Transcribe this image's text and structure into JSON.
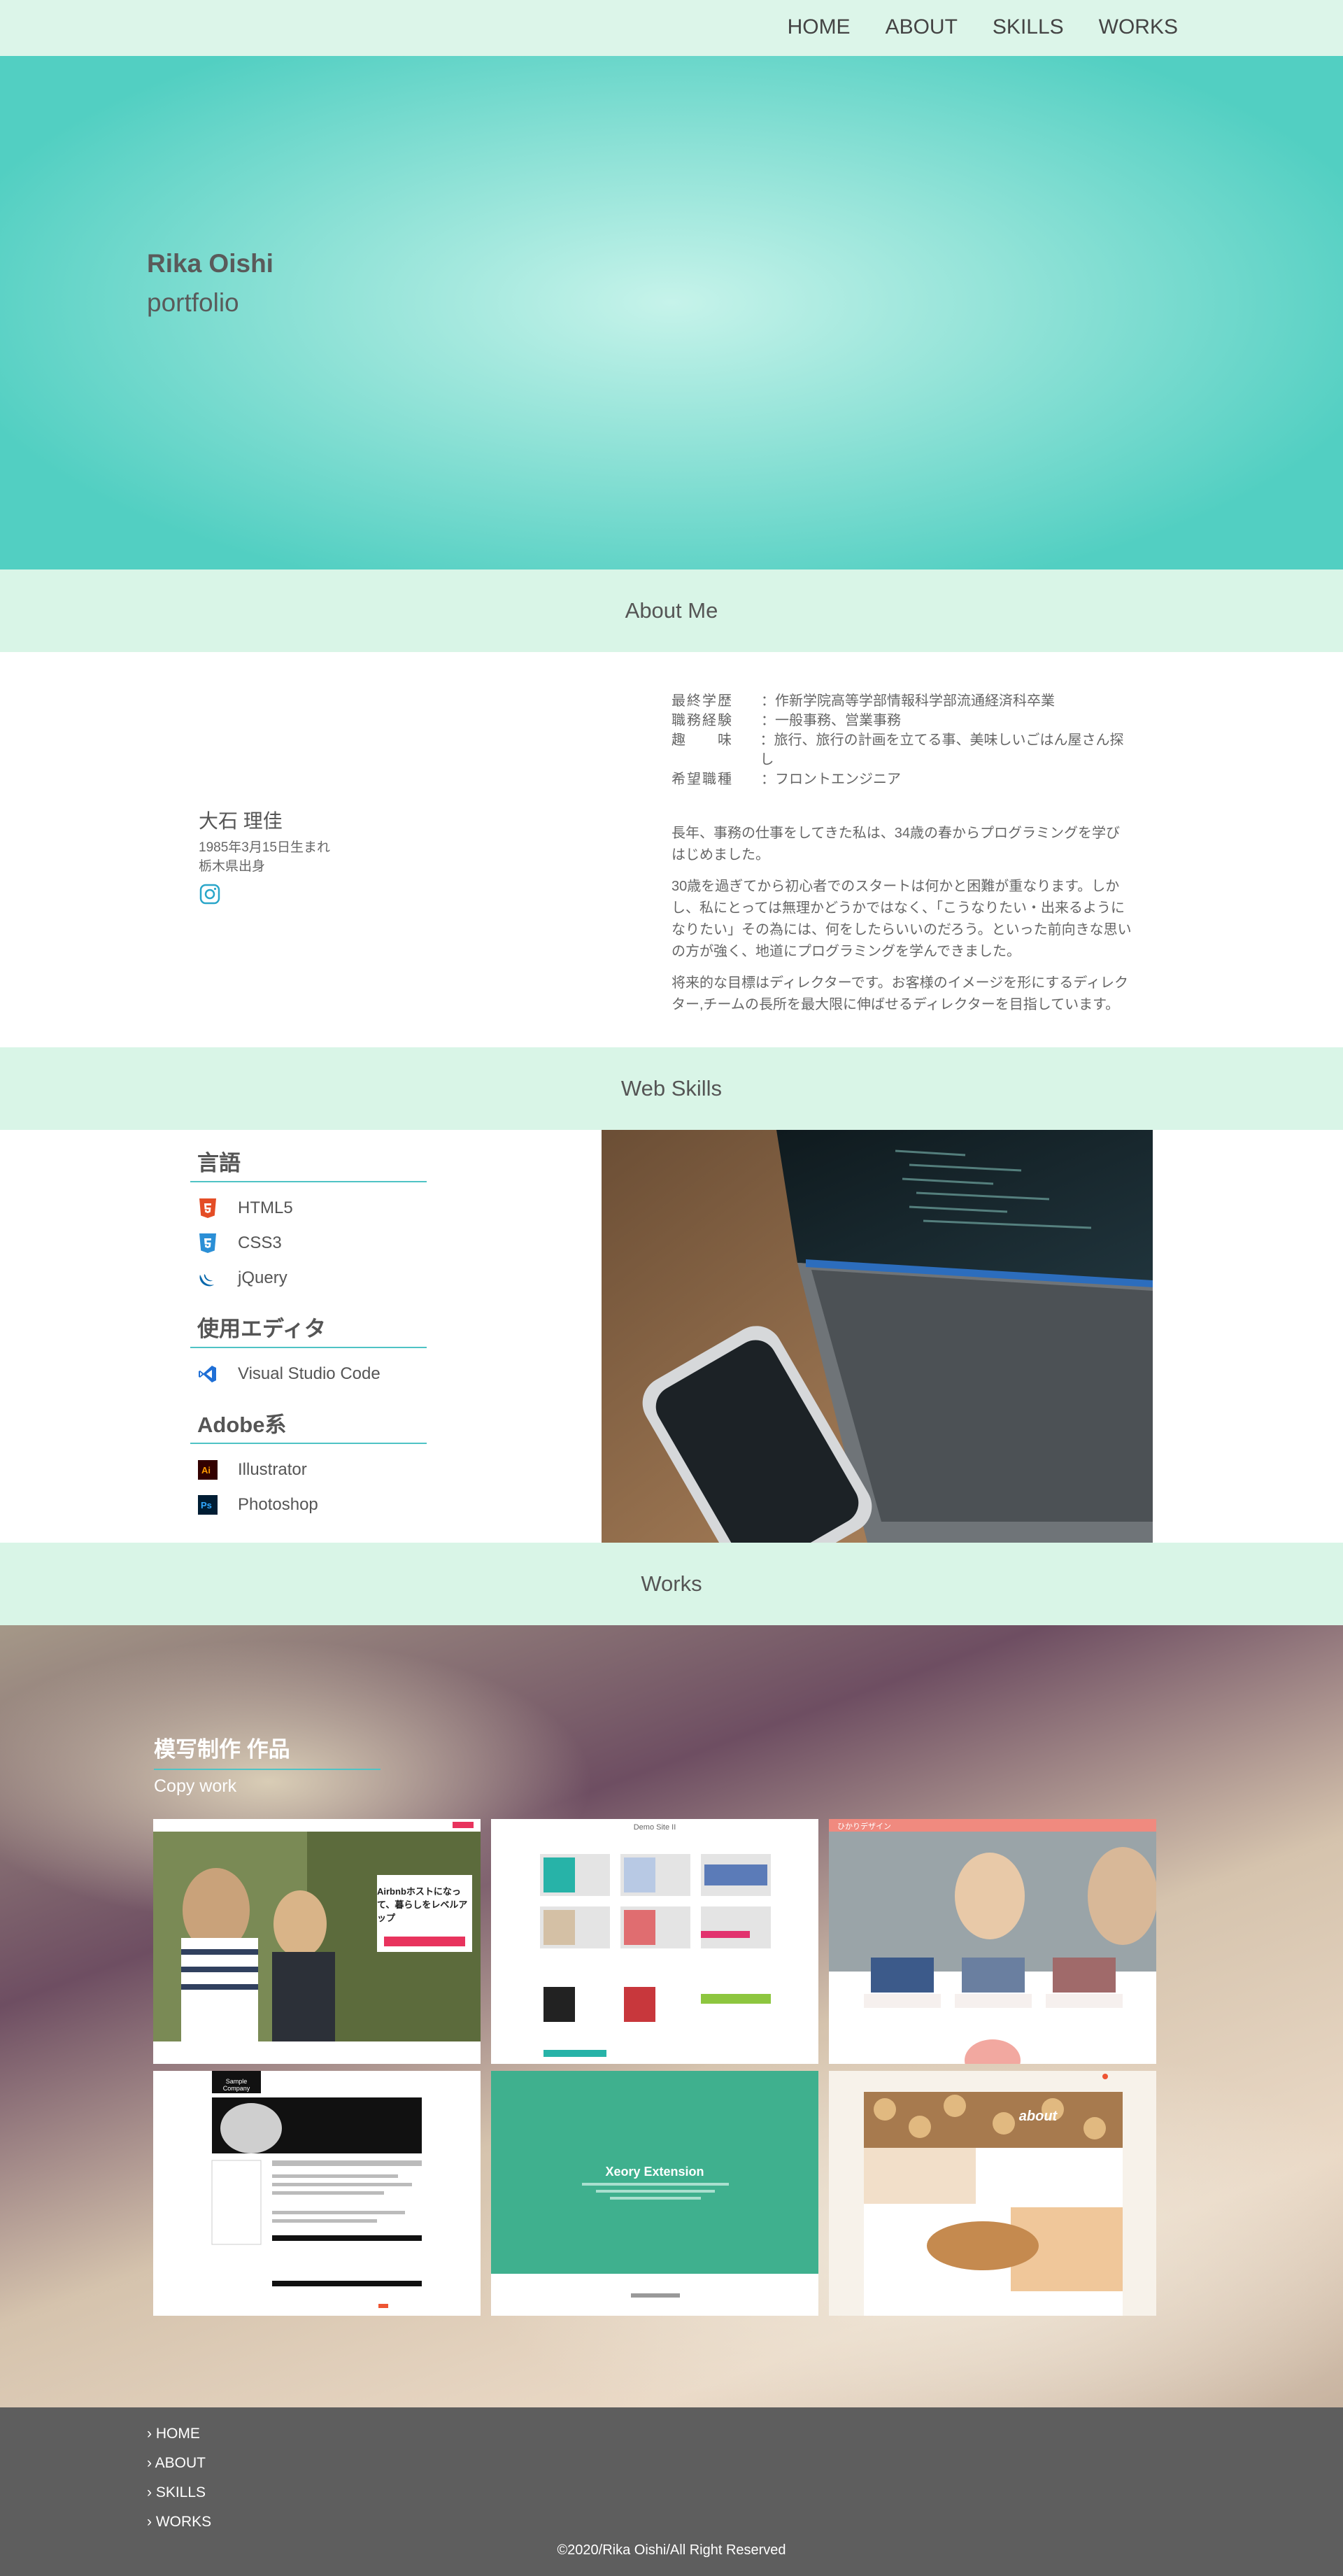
{
  "nav": {
    "items": [
      "HOME",
      "ABOUT",
      "SKILLS",
      "WORKS"
    ]
  },
  "hero": {
    "name": "Rika Oishi",
    "subtitle": "portfolio"
  },
  "about": {
    "heading": "About Me",
    "name_jp": "大石 理佳",
    "birth": "1985年3月15日生まれ",
    "origin": "栃木県出身",
    "details": [
      {
        "key": "最終学歴",
        "value": "：作新学院高等学部情報科学部流通経済科卒業"
      },
      {
        "key": "職務経験",
        "value": "：一般事務、営業事務"
      },
      {
        "key": "趣　　味",
        "value": "：旅行、旅行の計画を立てる事、美味しいごはん屋さん探し"
      },
      {
        "key": "希望職種",
        "value": "：フロントエンジニア"
      }
    ],
    "paragraphs": [
      "長年、事務の仕事をしてきた私は、34歳の春からプログラミングを学びはじめました。",
      "30歳を過ぎてから初心者でのスタートは何かと困難が重なります。しかし、私にとっては無理かどうかではなく、「こうなりたい・出来るようになりたい」その為には、何をしたらいいのだろう。といった前向きな思いの方が強く、地道にプログラミングを学んできました。",
      "将来的な目標はディレクターです。お客様のイメージを形にするディレクター,チームの長所を最大限に伸ばせるディレクターを目指しています。"
    ]
  },
  "skills": {
    "heading": "Web Skills",
    "categories": [
      {
        "title": "言語",
        "items": [
          "HTML5",
          "CSS3",
          "jQuery"
        ]
      },
      {
        "title": "使用エディタ",
        "items": [
          "Visual Studio Code"
        ]
      },
      {
        "title": "Adobe系",
        "items": [
          "Illustrator",
          "Photoshop"
        ]
      }
    ]
  },
  "works": {
    "heading": "Works",
    "title": "模写制作 作品",
    "subtitle": "Copy work",
    "cards": [
      {
        "caption": "Airbnbホストになって、暮らしをレベルアップ"
      },
      {
        "caption": "Demo Site II"
      },
      {
        "caption": "ひかりデザイン"
      },
      {
        "caption": "Sample Company"
      },
      {
        "caption": "Xeory Extension"
      },
      {
        "caption": "about"
      }
    ]
  },
  "footer": {
    "links": [
      "HOME",
      "ABOUT",
      "SKILLS",
      "WORKS"
    ],
    "copyright": "©2020/Rika Oishi/All Right Reserved"
  },
  "colors": {
    "accent": "#4fc3c5",
    "band": "#d9f5e7",
    "hero": "#52cfc2",
    "footer": "#5e5e5e"
  }
}
